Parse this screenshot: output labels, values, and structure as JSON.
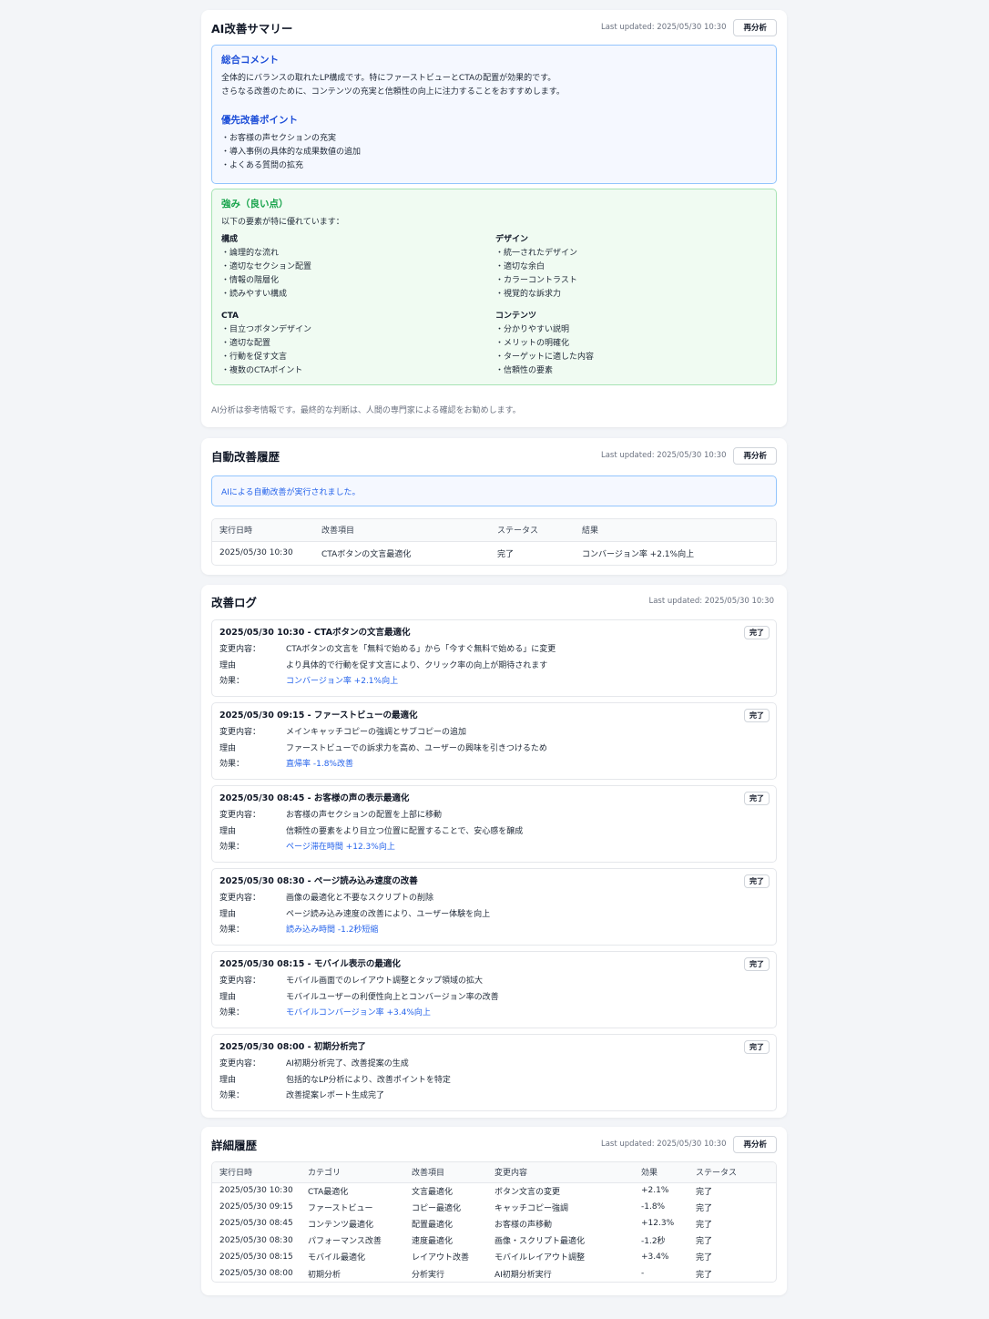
{
  "summary": {
    "title": "AI改善サマリー",
    "updated": "Last updated: 2025/05/30 10:30",
    "reanalyze": "再分析",
    "overall_heading": "総合コメント",
    "overall_lines": [
      "全体的にバランスの取れたLP構成です。特にファーストビューとCTAの配置が効果的です。",
      "さらなる改善のために、コンテンツの充実と信頼性の向上に注力することをおすすめします。"
    ],
    "priority_heading": "優先改善ポイント",
    "priority_items": [
      "・お客様の声セクションの充実",
      "・導入事例の具体的な成果数値の追加",
      "・よくある質問の拡充"
    ],
    "strengths_heading": "強み（良い点）",
    "strengths_intro": "以下の要素が特に優れています：",
    "groups": [
      {
        "name": "構成",
        "items": [
          "・論理的な流れ",
          "・適切なセクション配置",
          "・情報の階層化",
          "・読みやすい構成"
        ]
      },
      {
        "name": "デザイン",
        "items": [
          "・統一されたデザイン",
          "・適切な余白",
          "・カラーコントラスト",
          "・視覚的な訴求力"
        ]
      },
      {
        "name": "CTA",
        "items": [
          "・目立つボタンデザイン",
          "・適切な配置",
          "・行動を促す文言",
          "・複数のCTAポイント"
        ]
      },
      {
        "name": "コンテンツ",
        "items": [
          "・分かりやすい説明",
          "・メリットの明確化",
          "・ターゲットに適した内容",
          "・信頼性の要素"
        ]
      }
    ],
    "disclaimer": "AI分析は参考情報です。最終的な判断は、人間の専門家による確認をお勧めします。"
  },
  "auto": {
    "title": "自動改善履歴",
    "updated": "Last updated: 2025/05/30 10:30",
    "reanalyze": "再分析",
    "info": "AIによる自動改善が実行されました。",
    "headers": [
      "実行日時",
      "改善項目",
      "ステータス",
      "結果"
    ],
    "rows": [
      [
        "2025/05/30 10:30",
        "CTAボタンの文言最適化",
        "完了",
        "コンバージョン率 +2.1%向上"
      ]
    ]
  },
  "log": {
    "title": "改善ログ",
    "updated": "Last updated: 2025/05/30 10:30",
    "labels": {
      "change": "変更内容：",
      "reason": "理由",
      "effect": "効果："
    },
    "entries": [
      {
        "title": "2025/05/30 10:30 - CTAボタンの文言最適化",
        "badge": "完了",
        "change": "CTAボタンの文言を「無料で始める」から「今すぐ無料で始める」に変更",
        "reason": "より具体的で行動を促す文言により、クリック率の向上が期待されます",
        "effect": "コンバージョン率 +2.1%向上",
        "effect_link": true
      },
      {
        "title": "2025/05/30 09:15 - ファーストビューの最適化",
        "badge": "完了",
        "change": "メインキャッチコピーの強調とサブコピーの追加",
        "reason": "ファーストビューでの訴求力を高め、ユーザーの興味を引きつけるため",
        "effect": "直帰率 -1.8%改善",
        "effect_link": true
      },
      {
        "title": "2025/05/30 08:45 - お客様の声の表示最適化",
        "badge": "完了",
        "change": "お客様の声セクションの配置を上部に移動",
        "reason": "信頼性の要素をより目立つ位置に配置することで、安心感を醸成",
        "effect": "ページ滞在時間 +12.3%向上",
        "effect_link": true
      },
      {
        "title": "2025/05/30 08:30 - ページ読み込み速度の改善",
        "badge": "完了",
        "change": "画像の最適化と不要なスクリプトの削除",
        "reason": "ページ読み込み速度の改善により、ユーザー体験を向上",
        "effect": "読み込み時間 -1.2秒短縮",
        "effect_link": true
      },
      {
        "title": "2025/05/30 08:15 - モバイル表示の最適化",
        "badge": "完了",
        "change": "モバイル画面でのレイアウト調整とタップ領域の拡大",
        "reason": "モバイルユーザーの利便性向上とコンバージョン率の改善",
        "effect": "モバイルコンバージョン率 +3.4%向上",
        "effect_link": true
      },
      {
        "title": "2025/05/30 08:00 - 初期分析完了",
        "badge": "完了",
        "change": "AI初期分析完了、改善提案の生成",
        "reason": "包括的なLP分析により、改善ポイントを特定",
        "effect": "改善提案レポート生成完了",
        "effect_link": false
      }
    ]
  },
  "detail": {
    "title": "詳細履歴",
    "updated": "Last updated: 2025/05/30 10:30",
    "reanalyze": "再分析",
    "headers": [
      "実行日時",
      "カテゴリ",
      "改善項目",
      "変更内容",
      "効果",
      "ステータス"
    ],
    "rows": [
      [
        "2025/05/30 10:30",
        "CTA最適化",
        "文言最適化",
        "ボタン文言の変更",
        "+2.1%",
        "完了"
      ],
      [
        "2025/05/30 09:15",
        "ファーストビュー",
        "コピー最適化",
        "キャッチコピー強調",
        "-1.8%",
        "完了"
      ],
      [
        "2025/05/30 08:45",
        "コンテンツ最適化",
        "配置最適化",
        "お客様の声移動",
        "+12.3%",
        "完了"
      ],
      [
        "2025/05/30 08:30",
        "パフォーマンス改善",
        "速度最適化",
        "画像・スクリプト最適化",
        "-1.2秒",
        "完了"
      ],
      [
        "2025/05/30 08:15",
        "モバイル最適化",
        "レイアウト改善",
        "モバイルレイアウト調整",
        "+3.4%",
        "完了"
      ],
      [
        "2025/05/30 08:00",
        "初期分析",
        "分析実行",
        "AI初期分析実行",
        "-",
        "完了"
      ]
    ]
  }
}
